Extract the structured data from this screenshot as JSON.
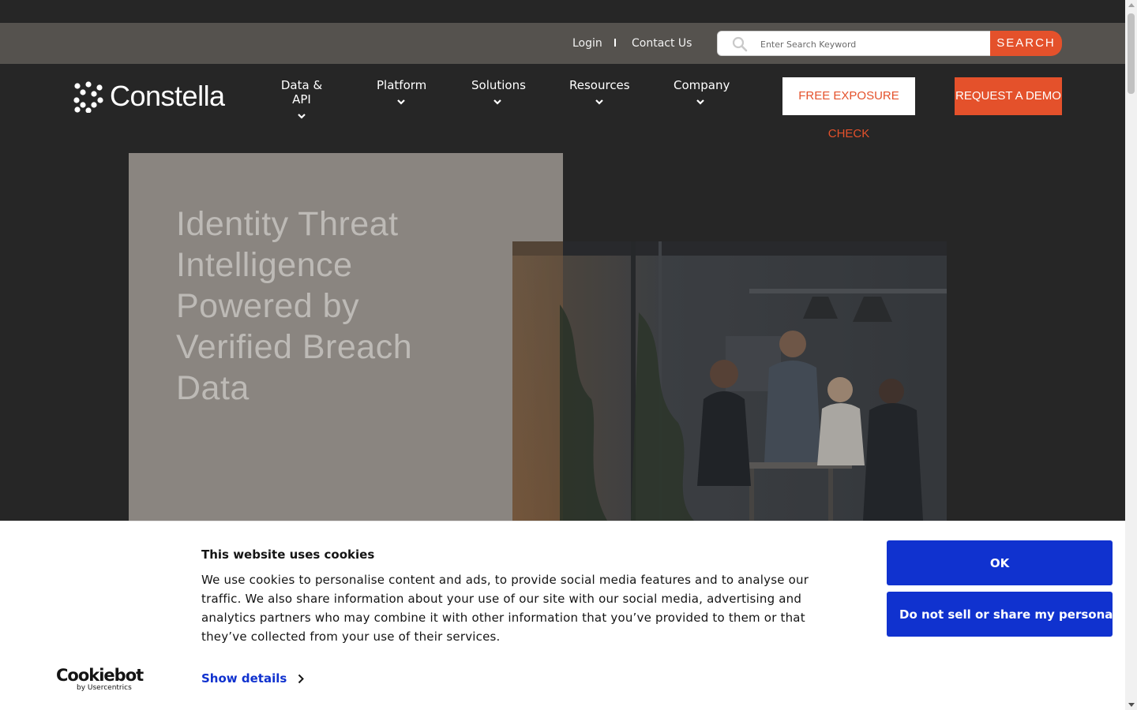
{
  "utility": {
    "login_label": "Login",
    "contact_label": "Contact Us",
    "search_placeholder": "Enter Search Keyword",
    "search_button": "SEARCH"
  },
  "brand": {
    "name": "Constella",
    "accent_color": "#e4512b"
  },
  "nav": {
    "items": [
      {
        "label": "Data & API"
      },
      {
        "label": "Platform"
      },
      {
        "label": "Solutions"
      },
      {
        "label": "Resources"
      },
      {
        "label": "Company"
      }
    ],
    "free_check_button": "FREE EXPOSURE CHECK",
    "demo_button": "REQUEST A DEMO"
  },
  "hero": {
    "title": "Identity Threat Intelligence Powered by Verified Breach Data"
  },
  "cookie_banner": {
    "title": "This website uses cookies",
    "body": "We use cookies to personalise content and ads, to provide social media features and to analyse our traffic. We also share information about your use of our site with our social media, advertising and analytics partners who may combine it with other information that you’ve provided to them or that they’ve collected from your use of their services.",
    "show_details": "Show details",
    "ok_button": "OK",
    "do_not_sell_button": "Do not sell or share my personal information",
    "logo_main": "Cookiebot",
    "logo_sub": "by Usercentrics",
    "button_color": "#1032cf"
  }
}
